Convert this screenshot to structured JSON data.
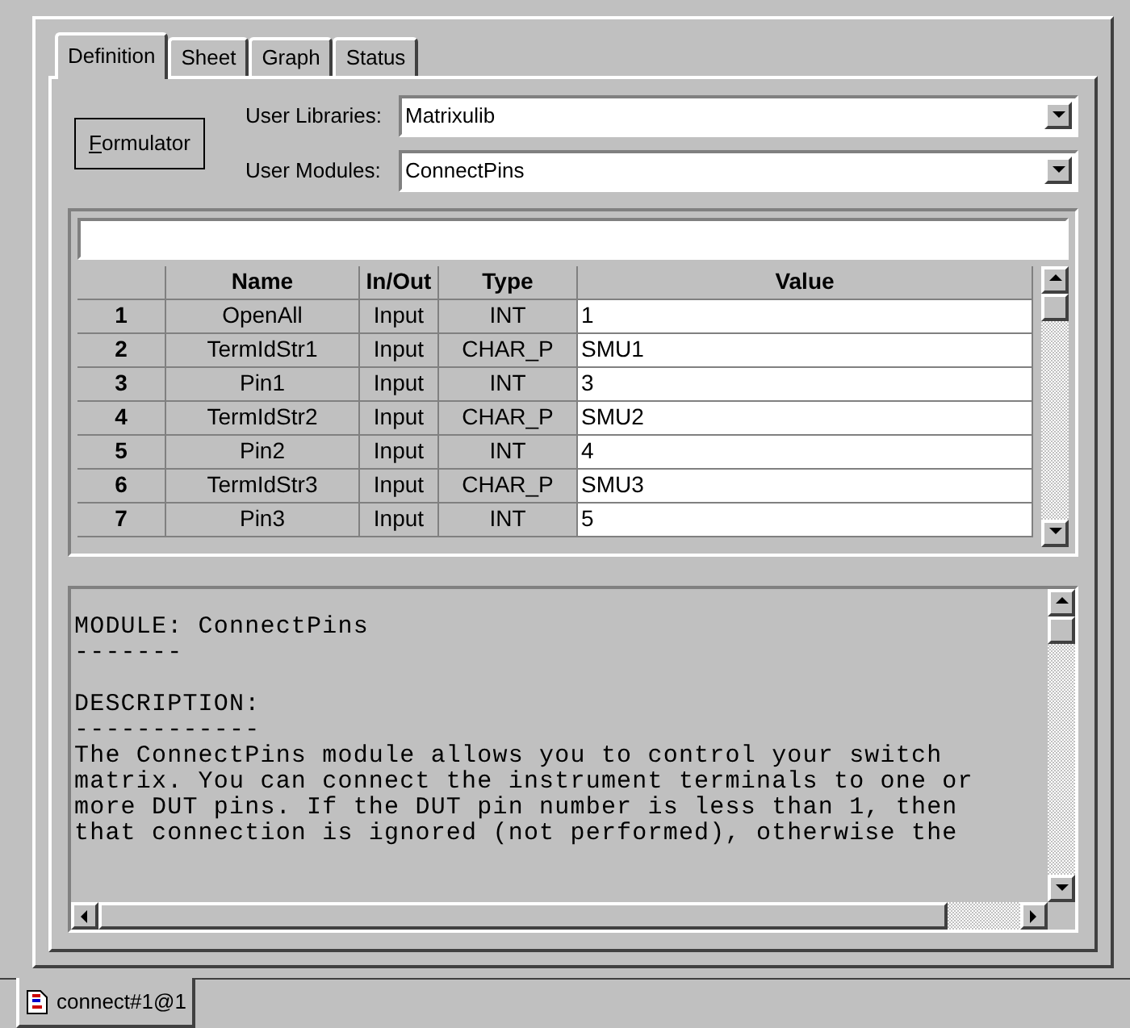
{
  "tabs": [
    {
      "label": "Definition",
      "selected": true
    },
    {
      "label": "Sheet",
      "selected": false
    },
    {
      "label": "Graph",
      "selected": false
    },
    {
      "label": "Status",
      "selected": false
    }
  ],
  "formulator_button": {
    "label": "Formulator"
  },
  "fields": [
    {
      "label": "User Libraries:",
      "value": "Matrixulib"
    },
    {
      "label": "User Modules:",
      "value": "ConnectPins"
    }
  ],
  "grid": {
    "columns": [
      "Name",
      "In/Out",
      "Type",
      "Value"
    ],
    "rows": [
      {
        "index": "1",
        "name": "OpenAll",
        "in_out": "Input",
        "type": "INT",
        "value": "1"
      },
      {
        "index": "2",
        "name": "TermIdStr1",
        "in_out": "Input",
        "type": "CHAR_P",
        "value": "SMU1"
      },
      {
        "index": "3",
        "name": "Pin1",
        "in_out": "Input",
        "type": "INT",
        "value": "3"
      },
      {
        "index": "4",
        "name": "TermIdStr2",
        "in_out": "Input",
        "type": "CHAR_P",
        "value": "SMU2"
      },
      {
        "index": "5",
        "name": "Pin2",
        "in_out": "Input",
        "type": "INT",
        "value": "4"
      },
      {
        "index": "6",
        "name": "TermIdStr3",
        "in_out": "Input",
        "type": "CHAR_P",
        "value": "SMU3"
      },
      {
        "index": "7",
        "name": "Pin3",
        "in_out": "Input",
        "type": "INT",
        "value": "5"
      }
    ]
  },
  "description": {
    "sections": [
      {
        "heading": "MODULE: ConnectPins",
        "rule": "-------"
      },
      {
        "heading": "DESCRIPTION:",
        "rule": "------------",
        "lines": [
          "The ConnectPins module allows you to control your switch",
          "matrix. You can connect the instrument terminals to one or",
          "more DUT pins. If the DUT pin number is less than 1, then",
          "that connection is ignored (not performed), otherwise the"
        ]
      }
    ]
  },
  "document_tabs": [
    {
      "label": "connect#1@1",
      "selected": true
    }
  ]
}
